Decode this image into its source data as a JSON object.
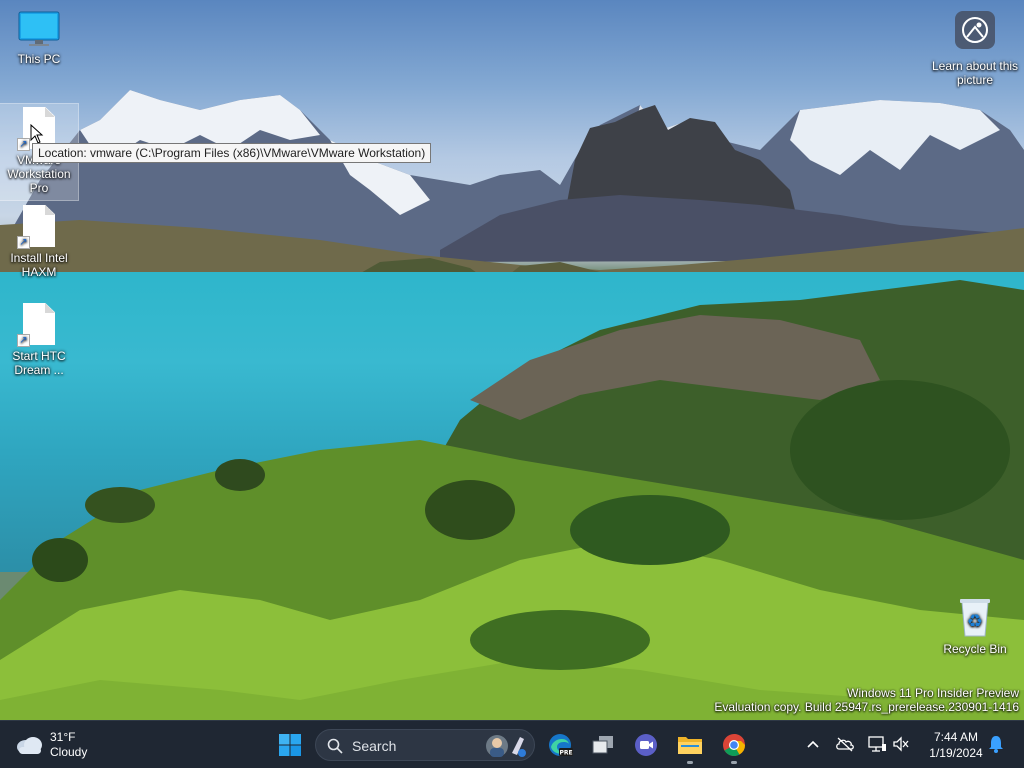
{
  "desktop": {
    "icons": [
      {
        "label": "This PC"
      },
      {
        "label": "VMware Workstation Pro"
      },
      {
        "label": "Install Intel HAXM"
      },
      {
        "label": "Start HTC Dream ..."
      },
      {
        "label": "Recycle Bin"
      }
    ],
    "learn_about": {
      "label": "Learn about this picture"
    },
    "tooltip": "Location: vmware (C:\\Program Files (x86)\\VMware\\VMware Workstation)",
    "watermark": {
      "line1": "Windows 11 Pro Insider Preview",
      "line2": "Evaluation copy. Build 25947.rs_prerelease.230901-1416"
    }
  },
  "taskbar": {
    "weather": {
      "temp": "31°F",
      "condition": "Cloudy"
    },
    "search_placeholder": "Search",
    "pinned": [
      {
        "name": "edge-preview-icon"
      },
      {
        "name": "task-view-icon"
      },
      {
        "name": "teams-meet-icon"
      },
      {
        "name": "file-explorer-icon"
      },
      {
        "name": "chrome-icon"
      }
    ],
    "clock": {
      "time": "7:44 AM",
      "date": "1/19/2024"
    }
  },
  "colors": {
    "taskbar_bg": "#1f2733",
    "accent": "#0078d4"
  }
}
